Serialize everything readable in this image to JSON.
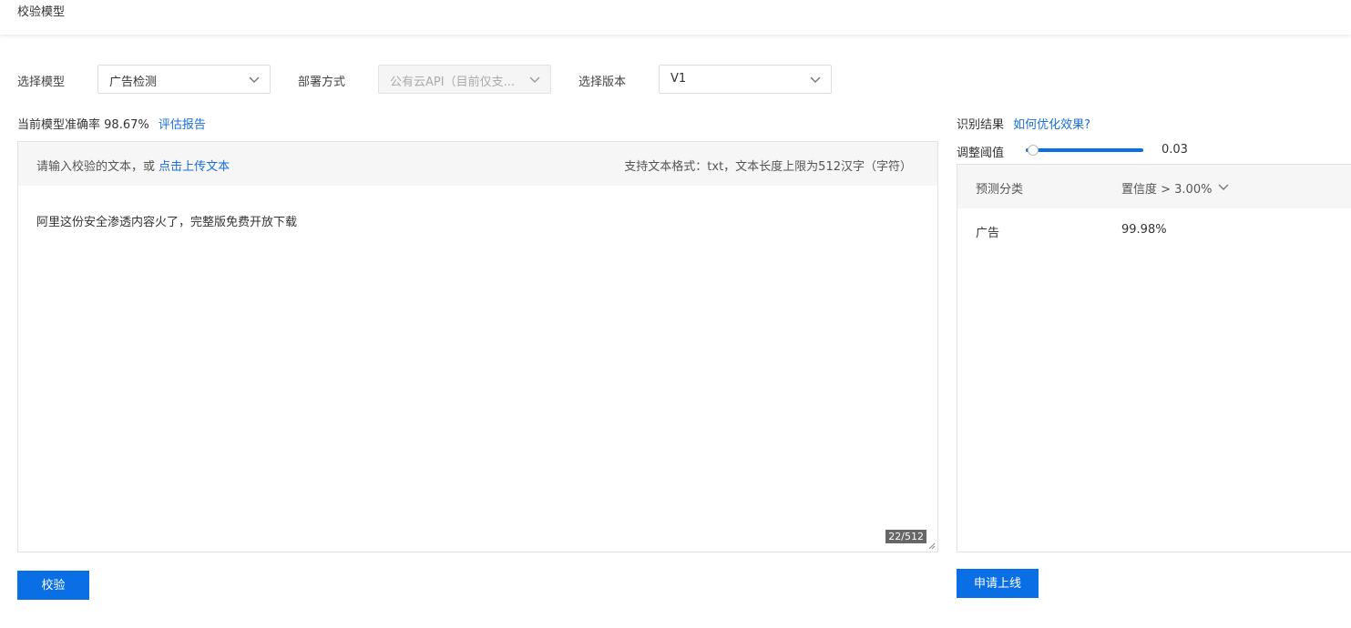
{
  "header": {
    "title": "校验模型"
  },
  "filters": {
    "model_label": "选择模型",
    "model_value": "广告检测",
    "deploy_label": "部署方式",
    "deploy_value": "公有云API（目前仅支...",
    "version_label": "选择版本",
    "version_value": "V1"
  },
  "accuracy": {
    "label": "当前模型准确率",
    "value": "98.67%",
    "report_link": "评估报告"
  },
  "editor": {
    "hint": "请输入校验的文本，或",
    "upload_link": "点击上传文本",
    "format_hint": "支持文本格式：txt，文本长度上限为512汉字（字符）",
    "content": "阿里这份安全渗透内容火了，完整版免费开放下载",
    "counter": "22/512"
  },
  "actions": {
    "verify_label": "校验",
    "apply_label": "申请上线"
  },
  "result": {
    "title": "识别结果",
    "optimize_link": "如何优化效果?",
    "threshold_label": "调整阈值",
    "threshold_value": "0.03",
    "col_class": "预测分类",
    "col_conf": "置信度 > 3.00%",
    "rows": [
      {
        "category": "广告",
        "confidence": "99.98%"
      }
    ]
  },
  "colors": {
    "accent": "#0a6ee5",
    "link": "#1a6ee0"
  }
}
